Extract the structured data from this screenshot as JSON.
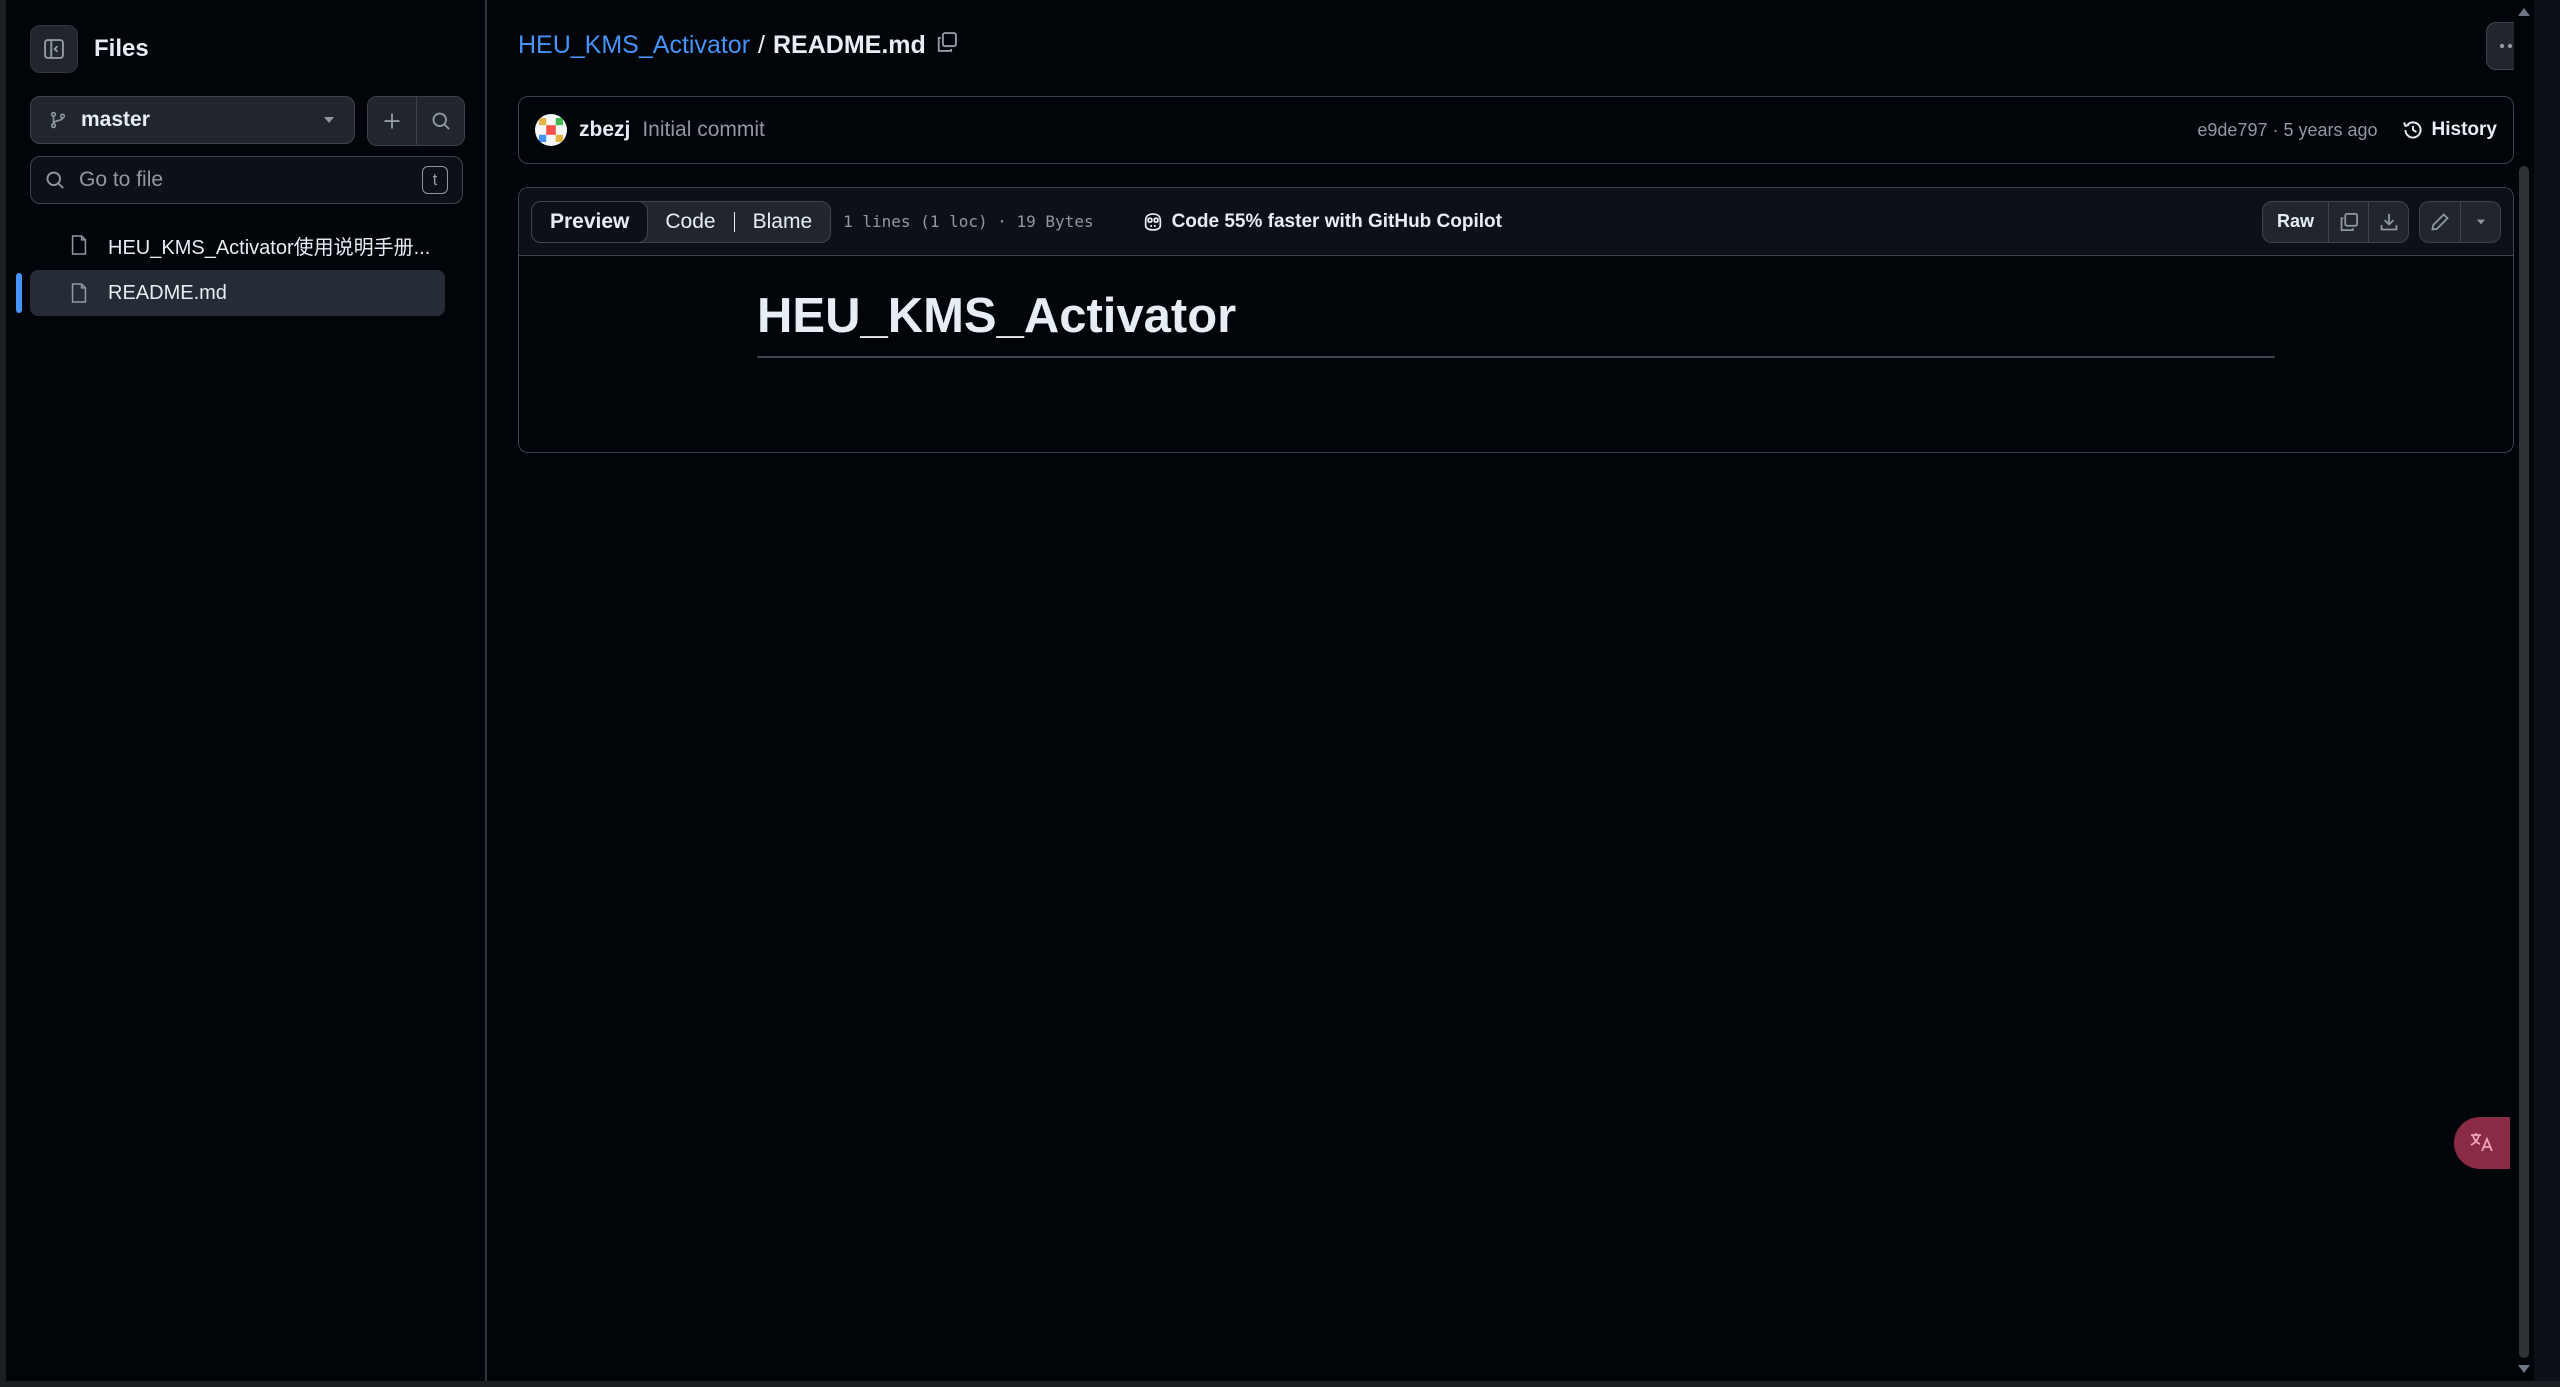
{
  "sidebar": {
    "title": "Files",
    "branch": "master",
    "search_placeholder": "Go to file",
    "search_shortcut": "t",
    "files": [
      {
        "name": "HEU_KMS_Activator使用说明手册..."
      },
      {
        "name": "README.md"
      }
    ]
  },
  "breadcrumb": {
    "repo": "HEU_KMS_Activator",
    "separator": "/",
    "file": "README.md"
  },
  "commit": {
    "author": "zbezj",
    "message": "Initial commit",
    "meta": "e9de797 · 5 years ago",
    "history_label": "History"
  },
  "file_view": {
    "tabs": [
      "Preview",
      "Code",
      "Blame"
    ],
    "active_tab": "Preview",
    "stats": "1 lines (1 loc) · 19 Bytes",
    "copilot_label": "Code 55% faster with GitHub Copilot",
    "raw_label": "Raw",
    "heading": "HEU_KMS_Activator"
  },
  "colors": {
    "background": "#010409",
    "accent": "#4493f8",
    "border": "#3d444d"
  },
  "icons": [
    "sidebar-toggle-icon",
    "branch-icon",
    "chevron-down-icon",
    "plus-icon",
    "search-icon",
    "file-icon",
    "copy-icon",
    "kebab-icon",
    "history-icon",
    "copilot-icon",
    "download-icon",
    "pencil-icon",
    "translate-icon"
  ]
}
